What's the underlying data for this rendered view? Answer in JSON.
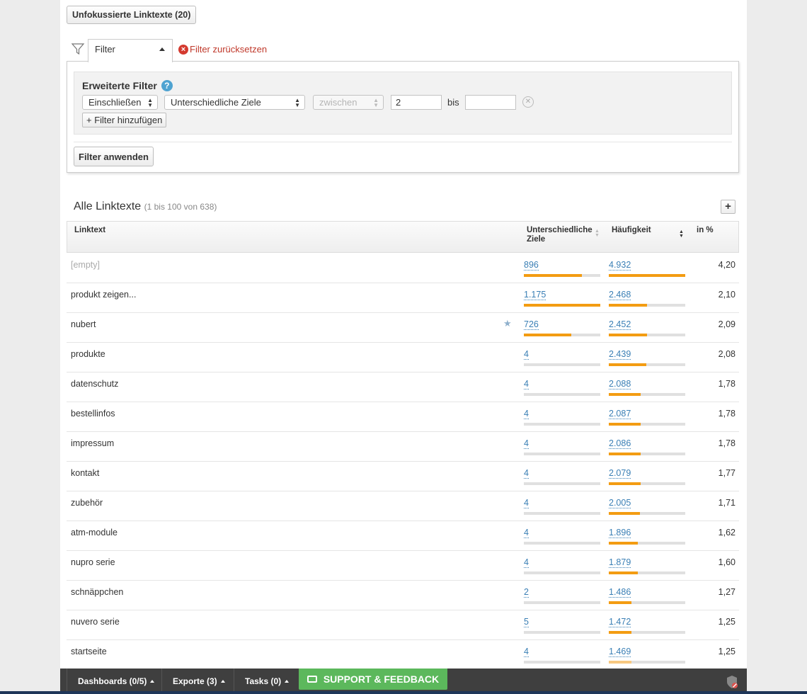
{
  "top_button": "Unfokussierte Linktexte (20)",
  "filter": {
    "tab_label": "Filter",
    "reset_label": "Filter zurücksetzen",
    "advanced_title": "Erweiterte Filter",
    "help_glyph": "?",
    "include_select": "Einschließen",
    "metric_select": "Unterschiedliche Ziele",
    "operator_select": "zwischen",
    "from_value": "2",
    "bis_label": "bis",
    "to_value": "",
    "add_filter_label": "+ Filter hinzufügen",
    "apply_label": "Filter anwenden"
  },
  "table": {
    "title": "Alle Linktexte",
    "subtitle": "(1 bis 100 von 638)",
    "plus": "+",
    "headers": {
      "linktext": "Linktext",
      "targets_line1": "Unterschiedliche",
      "targets_line2": "Ziele",
      "frequency": "Häufigkeit",
      "percent": "in %"
    },
    "rows": [
      {
        "text": "[empty]",
        "targets": "896",
        "targets_frac": 0.76,
        "freq": "4.932",
        "freq_frac": 1.0,
        "pct": "4,20",
        "starred": false
      },
      {
        "text": "produkt zeigen...",
        "targets": "1.175",
        "targets_frac": 1.0,
        "freq": "2.468",
        "freq_frac": 0.5,
        "pct": "2,10",
        "starred": false
      },
      {
        "text": "nubert",
        "targets": "726",
        "targets_frac": 0.62,
        "freq": "2.452",
        "freq_frac": 0.5,
        "pct": "2,09",
        "starred": true
      },
      {
        "text": "produkte",
        "targets": "4",
        "targets_frac": 0.0,
        "freq": "2.439",
        "freq_frac": 0.49,
        "pct": "2,08",
        "starred": false
      },
      {
        "text": "datenschutz",
        "targets": "4",
        "targets_frac": 0.0,
        "freq": "2.088",
        "freq_frac": 0.42,
        "pct": "1,78",
        "starred": false
      },
      {
        "text": "bestellinfos",
        "targets": "4",
        "targets_frac": 0.0,
        "freq": "2.087",
        "freq_frac": 0.42,
        "pct": "1,78",
        "starred": false
      },
      {
        "text": "impressum",
        "targets": "4",
        "targets_frac": 0.0,
        "freq": "2.086",
        "freq_frac": 0.42,
        "pct": "1,78",
        "starred": false
      },
      {
        "text": "kontakt",
        "targets": "4",
        "targets_frac": 0.0,
        "freq": "2.079",
        "freq_frac": 0.42,
        "pct": "1,77",
        "starred": false
      },
      {
        "text": "zubehör",
        "targets": "4",
        "targets_frac": 0.0,
        "freq": "2.005",
        "freq_frac": 0.41,
        "pct": "1,71",
        "starred": false
      },
      {
        "text": "atm-module",
        "targets": "4",
        "targets_frac": 0.0,
        "freq": "1.896",
        "freq_frac": 0.38,
        "pct": "1,62",
        "starred": false
      },
      {
        "text": "nupro serie",
        "targets": "4",
        "targets_frac": 0.0,
        "freq": "1.879",
        "freq_frac": 0.38,
        "pct": "1,60",
        "starred": false
      },
      {
        "text": "schnäppchen",
        "targets": "2",
        "targets_frac": 0.0,
        "freq": "1.486",
        "freq_frac": 0.3,
        "pct": "1,27",
        "starred": false
      },
      {
        "text": "nuvero serie",
        "targets": "5",
        "targets_frac": 0.0,
        "freq": "1.472",
        "freq_frac": 0.3,
        "pct": "1,25",
        "starred": false
      },
      {
        "text": "startseite",
        "targets": "4",
        "targets_frac": 0.0,
        "freq": "1.469",
        "freq_frac": 0.3,
        "pct": "1,25",
        "starred": false
      }
    ]
  },
  "bottom_bar": {
    "dashboards": "Dashboards (0/5)",
    "exports": "Exporte (3)",
    "tasks": "Tasks (0)",
    "support": "SUPPORT & FEEDBACK"
  },
  "colors": {
    "accent_bar": "#f39c12",
    "link": "#3a7fb5",
    "support_green": "#5cb85c",
    "reset_red": "#c0392b"
  }
}
